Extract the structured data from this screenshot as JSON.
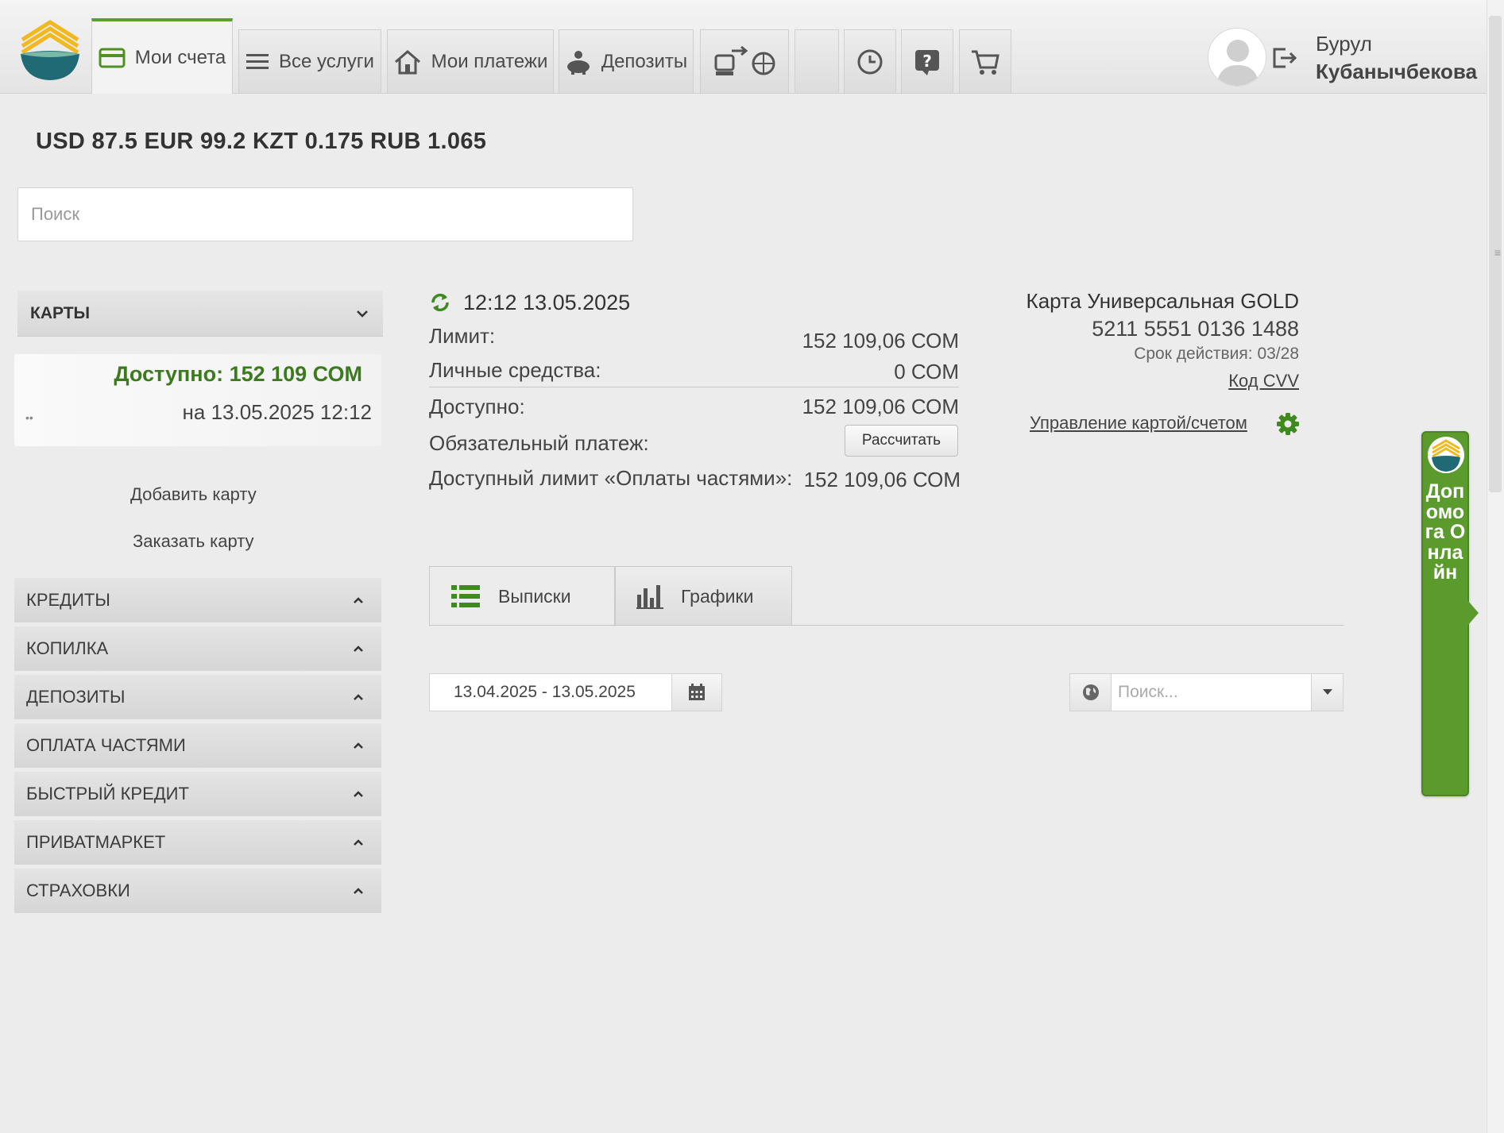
{
  "header": {
    "tabs": [
      {
        "label": "Мои счета"
      },
      {
        "label": "Все услуги"
      },
      {
        "label": "Мои платежи"
      },
      {
        "label": "Депозиты"
      }
    ],
    "icon_tabs": [
      "exchange-transport-icon",
      "history-icon",
      "help-icon",
      "cart-icon"
    ],
    "user": {
      "first_name": "Бурул",
      "last_name": "Кубанычбекова"
    }
  },
  "rates": "USD 87.5 EUR 99.2 KZT 0.175 RUB 1.065",
  "search": {
    "placeholder": "Поиск",
    "value": ""
  },
  "sidebar": {
    "cards_title": "КАРТЫ",
    "card": {
      "available": "Доступно: 152 109 СОМ",
      "date": "на 13.05.2025 12:12",
      "dots": "••"
    },
    "add_card": "Добавить карту",
    "order_card": "Заказать карту",
    "sections": [
      {
        "label": "КРЕДИТЫ"
      },
      {
        "label": "КОПИЛКА"
      },
      {
        "label": "ДЕПОЗИТЫ"
      },
      {
        "label": "ОПЛАТА ЧАСТЯМИ"
      },
      {
        "label": "БЫСТРЫЙ КРЕДИТ"
      },
      {
        "label": "ПРИВАТМАРКЕТ"
      },
      {
        "label": "СТРАХОВКИ"
      }
    ]
  },
  "details": {
    "timestamp": "12:12  13.05.2025",
    "limit_label": "Лимит:",
    "limit_value": "152 109,06 СОМ",
    "own_funds_label": "Личные средства:",
    "own_funds_value": "0 СОМ",
    "available_label": "Доступно:",
    "available_value": "152 109,06 СОМ",
    "mandatory_label": "Обязательный платеж:",
    "calc_button": "Рассчитать",
    "installment_label": "Доступный лимит «Оплаты частями»:",
    "installment_value": "152 109,06 СОМ"
  },
  "card_info": {
    "name": "Карта Универсальная GOLD",
    "number": "5211 5551 0136 1488",
    "expiry": "Срок действия: 03/28",
    "cvv_link": "Код CVV",
    "manage_link": "Управление картой/счетом"
  },
  "statement_tabs": [
    {
      "label": "Выписки"
    },
    {
      "label": "Графики"
    }
  ],
  "filters": {
    "date_range": "13.04.2025 - 13.05.2025",
    "search_placeholder": "Поиск..."
  },
  "help_widget": {
    "label": "Допомога Онлайн"
  },
  "colors": {
    "accent_green": "#5b9a2c",
    "available_green": "#3c7a1e",
    "logo_yellow": "#f2b81f",
    "logo_teal": "#1f6a74"
  }
}
